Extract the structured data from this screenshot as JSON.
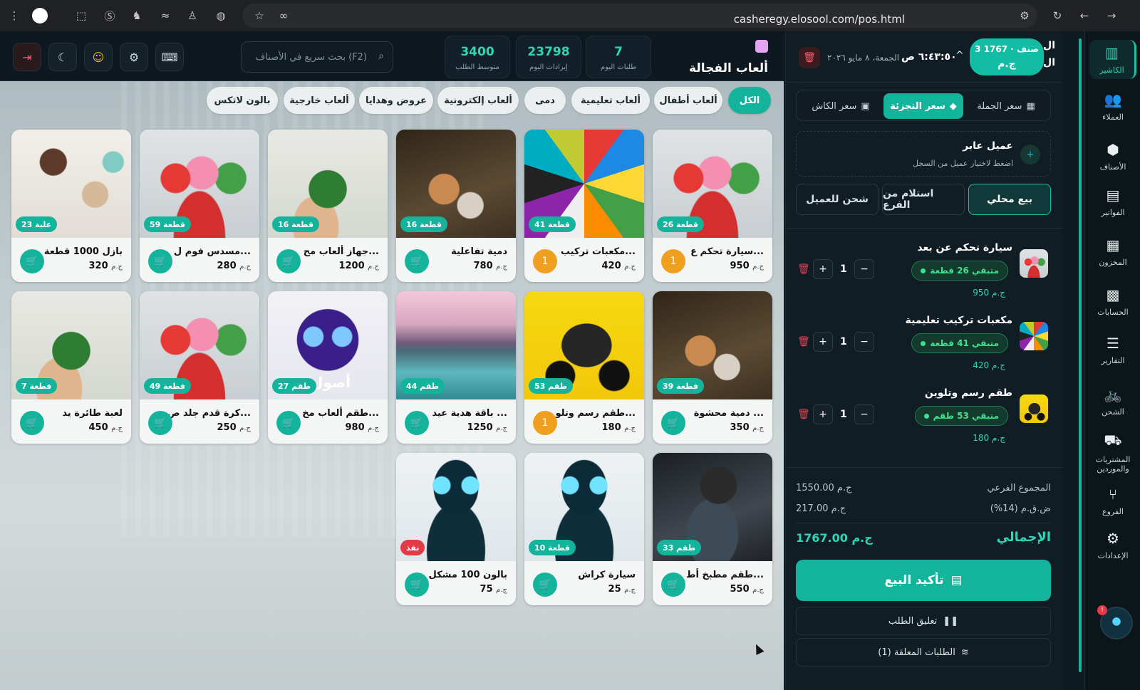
{
  "browser": {
    "url": "casheregy.elosool.com/pos.html"
  },
  "sidebar": {
    "items": [
      {
        "label": "الكاشير",
        "icon": "cashier-icon"
      },
      {
        "label": "العملاء",
        "icon": "customers-icon"
      },
      {
        "label": "الأصناف",
        "icon": "products-icon"
      },
      {
        "label": "الفواتير",
        "icon": "invoices-icon"
      },
      {
        "label": "المخزون",
        "icon": "inventory-icon"
      },
      {
        "label": "الحسابات",
        "icon": "accounts-icon"
      },
      {
        "label": "التقارير",
        "icon": "reports-icon"
      },
      {
        "label": "الشحن",
        "icon": "shipping-icon"
      },
      {
        "label": "المشتريات والموردين",
        "icon": "purchases-icon"
      },
      {
        "label": "الفروع",
        "icon": "branches-icon"
      },
      {
        "label": "الإعدادات",
        "icon": "settings-icon"
      }
    ],
    "notification_count": "!"
  },
  "cart": {
    "summary_line1": "3 صنف · 1767",
    "summary_line2": "ج.م",
    "title_clip_1": "ال",
    "title_clip_2": "ال",
    "time": "٦:٤٣:٥٠ ص",
    "date": "الجمعة، ٨ مايو ٢٠٢٦",
    "price_modes": [
      "سعر الجملة",
      "سعر التجزئة",
      "سعر الكاش"
    ],
    "active_price_mode": "سعر التجزئة",
    "customer": {
      "name": "عميل عابر",
      "hint": "اضغط لاختيار عميل من السجل"
    },
    "sale_modes": [
      "بيع محلي",
      "استلام من الفرع",
      "شحن للعميل"
    ],
    "active_sale_mode": "بيع محلي",
    "lines": [
      {
        "name": "سيارة تحكم عن بعد",
        "stock": "متبقي 26 قطعة",
        "price": "950 ج.م",
        "qty": "1"
      },
      {
        "name": "مكعبات تركيب تعليمية",
        "stock": "متبقي 41 قطعة",
        "price": "420 ج.م",
        "qty": "1"
      },
      {
        "name": "طقم رسم وتلوين",
        "stock": "متبقي 53 طقم",
        "price": "180 ج.م",
        "qty": "1"
      }
    ],
    "subtotal_label": "المجموع الفرعي",
    "subtotal_value": "1550.00 ج.م",
    "vat_label": "ض.ق.م (14%)",
    "vat_value": "217.00 ج.م",
    "total_label": "الإجمالي",
    "total_value": "1767.00 ج.م",
    "confirm_label": "تأكيد البيع",
    "suspend_label": "تعليق الطلب",
    "pending_label": "الطلبات المعلقة (1)"
  },
  "header": {
    "store_name": "ألعاب الفجالة",
    "stats": [
      {
        "value": "7",
        "label": "طلبات اليوم"
      },
      {
        "value": "23798",
        "label": "إيرادات اليوم"
      },
      {
        "value": "3400",
        "label": "متوسط الطلب"
      }
    ],
    "search_placeholder": "بحث سريع في الأصناف (F2)"
  },
  "categories": [
    "الكل",
    "ألعاب أطفال",
    "ألعاب تعليمية",
    "دمى",
    "ألعاب إلكترونية",
    "عروض وهدايا",
    "ألعاب خارجية",
    "بالون لاتكس"
  ],
  "active_category": "الكل",
  "currency": "ج.م",
  "products": [
    {
      "name": "سيارة تحكم ع...",
      "price": "950",
      "stock": "26 قطعة",
      "in_cart": "1",
      "img": "mario"
    },
    {
      "name": "مكعبات تركيب...",
      "price": "420",
      "stock": "41 قطعة",
      "in_cart": "1",
      "img": "lego"
    },
    {
      "name": "دمية تفاعلية",
      "price": "780",
      "stock": "16 قطعة",
      "in_cart": "",
      "img": "cats"
    },
    {
      "name": "جهاز ألعاب مح...",
      "price": "1200",
      "stock": "16 قطعة",
      "in_cart": "",
      "img": "bottle"
    },
    {
      "name": "مسدس فوم ل...",
      "price": "280",
      "stock": "59 قطعة",
      "in_cart": "",
      "img": "mario"
    },
    {
      "name": "بازل 1000 قطعة",
      "price": "320",
      "stock": "23 علبة",
      "in_cart": "",
      "img": "toys"
    },
    {
      "name": "دمية محشوة ...",
      "price": "350",
      "stock": "39 قطعة",
      "in_cart": "",
      "img": "cats"
    },
    {
      "name": "طقم رسم وتلو...",
      "price": "180",
      "stock": "53 طقم",
      "in_cart": "1",
      "img": "batcar"
    },
    {
      "name": "باقة هدية عيد ...",
      "price": "1250",
      "stock": "44 طقم",
      "in_cart": "",
      "img": "lake"
    },
    {
      "name": "طقم ألعاب مخ...",
      "price": "980",
      "stock": "27 طقم",
      "in_cart": "",
      "img": "robotpurple"
    },
    {
      "name": "كرة قدم جلد ص...",
      "price": "250",
      "stock": "49 قطعة",
      "in_cart": "",
      "img": "mario"
    },
    {
      "name": "لعبة طائرة يد",
      "price": "450",
      "stock": "7 قطعة",
      "in_cart": "",
      "img": "bottle"
    },
    {
      "name": "طقم مطبخ أط...",
      "price": "550",
      "stock": "33 طقم",
      "in_cart": "",
      "img": "welder"
    },
    {
      "name": "سيارة كراش",
      "price": "25",
      "stock": "10 قطعة",
      "in_cart": "",
      "img": "robot"
    },
    {
      "name": "بالون 100 مشكل",
      "price": "75",
      "stock": "نفذ",
      "in_cart": "",
      "img": "robot",
      "out": true
    }
  ],
  "robot_logo_text": "أصول"
}
